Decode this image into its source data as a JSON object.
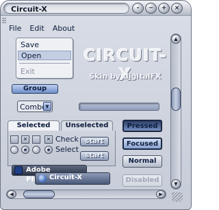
{
  "window": {
    "title": "Circuit-X"
  },
  "title_buttons": [
    "-",
    "−",
    "+",
    "×"
  ],
  "menu": [
    "File",
    "Edit",
    "About"
  ],
  "listbox": {
    "items": [
      "Save",
      "Open",
      "Exit"
    ],
    "selected": "Open",
    "disabled": "Exit"
  },
  "logo": {
    "main": "CIRCUIT-X",
    "sub": "Skin by digitalFX"
  },
  "group_button": "Group",
  "combo": {
    "value": "Combo",
    "arrow_icon": "triangle-down"
  },
  "progress": {
    "value": 0
  },
  "tabs": [
    {
      "label": "Selected",
      "active": true
    },
    {
      "label": "Unselected",
      "active": false
    }
  ],
  "checks": {
    "label": "Check",
    "states": [
      "unchecked",
      "checked",
      "unchecked",
      "checked"
    ]
  },
  "radios": {
    "label": "Select",
    "states": [
      "off",
      "on",
      "off",
      "on"
    ]
  },
  "start_buttons": [
    "start",
    "start"
  ],
  "taskbar": {
    "photoshop": "Adobe Photoshop",
    "circuitx": "Circuit-X"
  },
  "state_buttons": [
    "Pressed",
    "Focused",
    "Normal",
    "Disabled"
  ],
  "colors": {
    "accent": "#6f8fc7",
    "frame": "#c6ccd8",
    "dark": "#2c3448"
  }
}
